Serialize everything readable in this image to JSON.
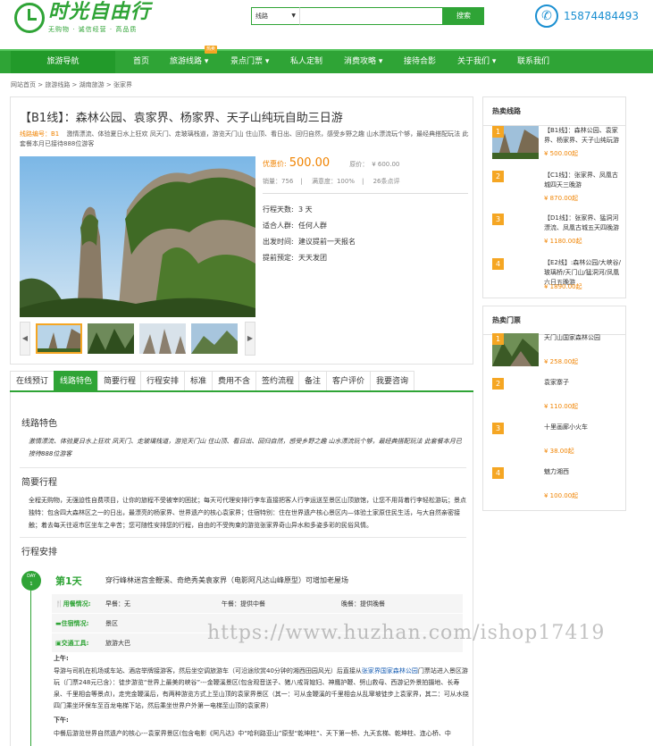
{
  "header": {
    "logo_title": "时光自由行",
    "logo_slogan": "无购物 · 诚信经营 · 高品质",
    "search_category": "线路",
    "search_button": "搜索",
    "phone": "15874484493"
  },
  "nav": {
    "guide": "旅游导航",
    "items": [
      "首页",
      "旅游线路 ▾",
      "景点门票 ▾",
      "私人定制",
      "消费攻略 ▾",
      "接待合影",
      "关于我们 ▾",
      "联系我们"
    ],
    "badge": "热卖"
  },
  "breadcrumb": [
    "网站首页",
    "旅游线路",
    "湖南旅游",
    "张家界"
  ],
  "product": {
    "title": "【B1线】：森林公园、袁家界、杨家界、天子山纯玩自助三日游",
    "code_label": "线路编号：B1",
    "code_desc": "激情漂流、体验夏日水上狂欢 凤天门、走玻璃栈道，游览天门山 住山顶、看日出、回归自然，感受乡野之趣 山水漂流玩个够，最经典搭配玩法 此套餐本月已接待888位游客",
    "price_label": "优惠价:",
    "price": "500.00",
    "orig_label": "原价：",
    "orig_price": "¥ 600.00",
    "sales": "销量：756",
    "satisfaction": "满意度：100%",
    "reviews": "26条点评",
    "specs": [
      {
        "k": "行程天数:",
        "v": "3 天"
      },
      {
        "k": "适合人群:",
        "v": "任何人群"
      },
      {
        "k": "出发时间:",
        "v": "建议提前一天报名"
      },
      {
        "k": "提前预定:",
        "v": "天天发团"
      }
    ]
  },
  "tabs": [
    "在线预订",
    "线路特色",
    "简要行程",
    "行程安排",
    "标准",
    "费用不含",
    "签约流程",
    "备注",
    "客户评价",
    "我要咨询"
  ],
  "detail": {
    "feature_title": "线路特色",
    "feature_text": "激情漂流、体验夏日水上狂欢 凤天门、走玻璃栈道，游览天门山 住山顶、看日出、回归自然，感受乡野之趣 山水漂流玩个够，最经典搭配玩法 此套餐本月已接待888位游客",
    "brief_title": "简要行程",
    "brief_text": "全程无购物，无强迫性自费项目，让你的旅程不受被宰的困扰；每天可代理安排行李车直接把客人行李运送至景区山顶旅馆，让您不用背着行李轻松游玩；景点独特：包含四大森林区之一的日出，最漂亮的杨家界、世界遗产的核心袁家界；住宿特别：住在世界遗产核心景区内—体验土家原住民生活，与大自然亲密接触；着去每天往返市区坐车之辛苦；您可随性安排您的行程，自由的不受拘束的游览张家界奇山异水和多姿多彩的民俗风情。",
    "schedule_title": "行程安排",
    "day_badge_top": "DAY",
    "day_badge_num": "1",
    "day_title": "第1天",
    "day_desc": "穿行峰林迷宫金鞭溪、奇绝秀美袁家界（电影阿凡达山峰原型）可增加老屋场",
    "meals_label": "用餐情况:",
    "breakfast": "早餐：无",
    "lunch": "午餐：提供中餐",
    "dinner": "晚餐：提供晚餐",
    "stay_label": "住宿情况:",
    "stay": "景区",
    "transport_label": "交通工具:",
    "transport": "旅游大巴",
    "am_label": "上午:",
    "am_pre": "导游与司机在机场或车站、酒店举牌接游客，然后坐空调旅游车（可沿途欣赏40分钟的湘西田园风光）后直接从",
    "am_link": "张家界国家森林公园",
    "am_post": "门票站进入景区游玩（门票248元已含）：徒步游览“世界上最美的峡谷”---金鞭溪景区(包含观音送子、猪八戒背媳妇、神鹰护鞭、劈山救母、西游记外景拍摄地、长寿泉、千里相会等景点)，走完金鞭溪后，有两种游览方式上至山顶的袁家界景区（其一：可从金鞭溪的千里相会从乱窜坡徒步上袁家界，其二：可从水绕四门乘坐环保车至百龙电梯下站，然后乘坐世界户外第一电梯至山顶的袁家界）",
    "pm_label": "下午:",
    "pm_text": "中餐后游览世界自然遗产的核心---袁家界景区(包含电影《阿凡达》中“哈利路亚山”原型“乾坤柱”、天下第一桥、九天玄梯、乾坤柱、连心桥、中"
  },
  "sidebar": {
    "hot_routes_title": "热卖线路",
    "hot_routes": [
      {
        "num": "1",
        "name": "【B1线】：森林公园、袁家界、杨家界、天子山纯玩游",
        "price": "¥ 500.00起"
      },
      {
        "num": "2",
        "name": "【C1线】：张家界、凤凰古城四天三晚游",
        "price": "¥ 870.00起"
      },
      {
        "num": "3",
        "name": "【D1线】：张家界、猛洞河漂流、凤凰古城五天四晚游",
        "price": "¥ 1180.00起"
      },
      {
        "num": "4",
        "name": "【E2线】:森林公园/大峡谷/玻璃桥/天门山/猛洞河/凤凰六日五晚游",
        "price": "¥ 1890.00起"
      }
    ],
    "hot_tickets_title": "热卖门票",
    "hot_tickets": [
      {
        "num": "1",
        "name": "天门山国家森林公园",
        "price": "¥ 258.00起"
      },
      {
        "num": "2",
        "name": "袁家寨子",
        "price": "¥ 110.00起"
      },
      {
        "num": "3",
        "name": "十里画廊小火车",
        "price": "¥ 38.00起"
      },
      {
        "num": "4",
        "name": "魅力湘西",
        "price": "¥ 100.00起"
      }
    ]
  },
  "watermark": "https://www.huzhan.com/ishop17419",
  "colors": {
    "brand": "#2fa436",
    "accent": "#f08300",
    "badge": "#f5a623",
    "phone": "#1a8fd1"
  }
}
